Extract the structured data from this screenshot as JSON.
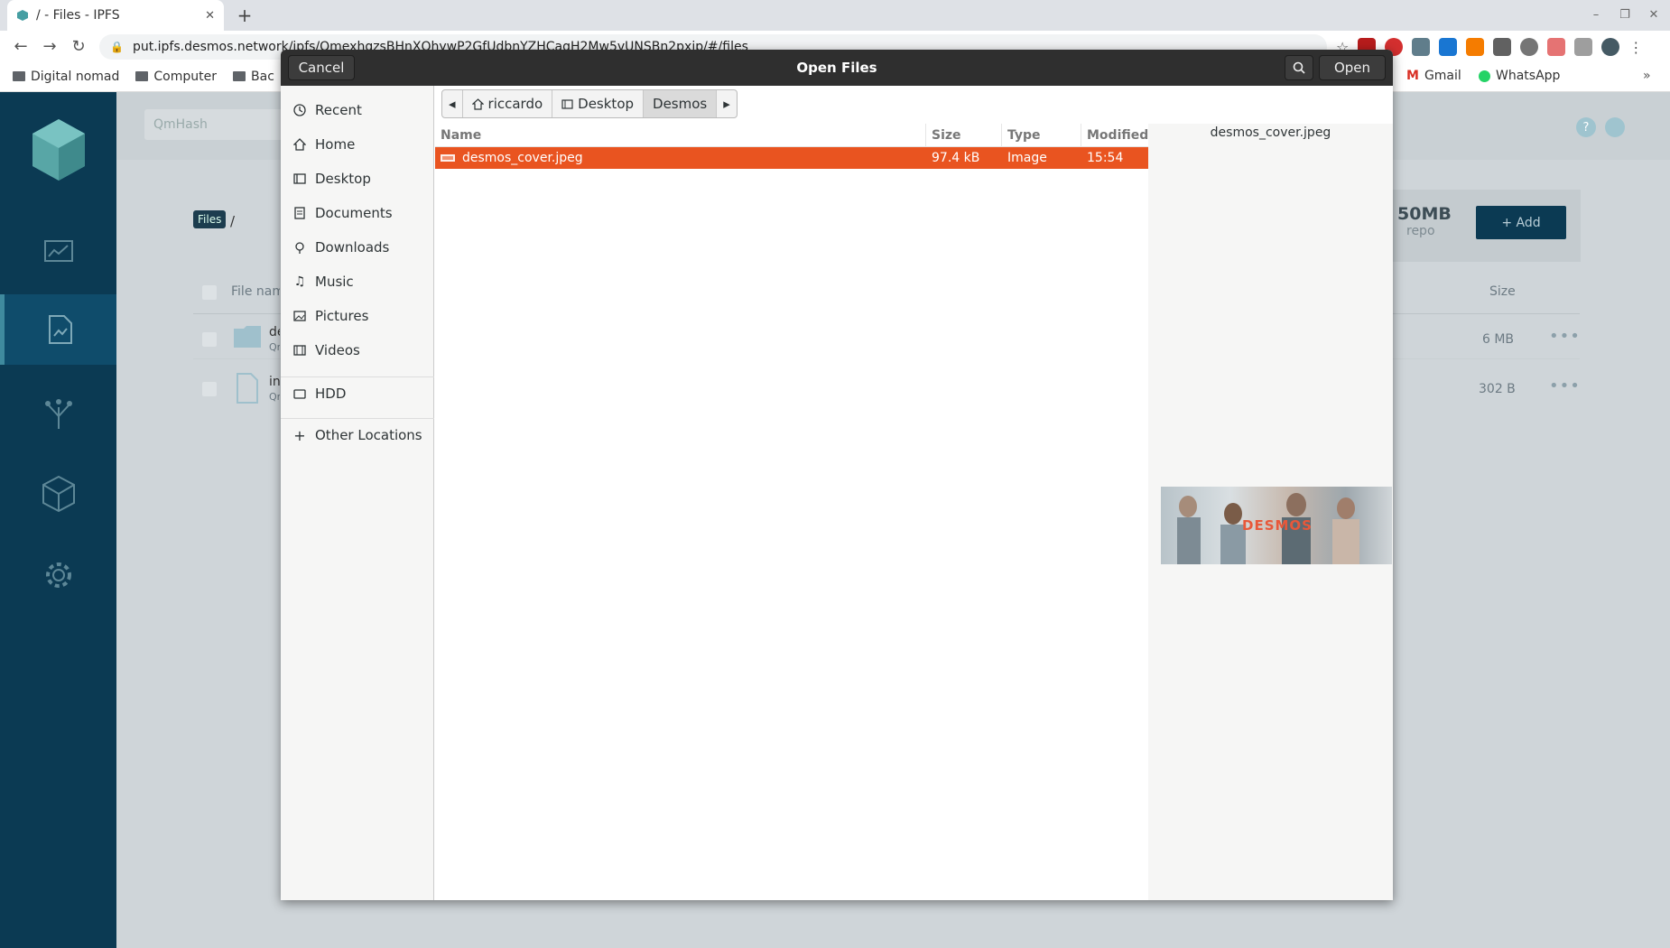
{
  "browser": {
    "tab_title": "/ - Files - IPFS",
    "new_tab": "+",
    "url": "put.ipfs.desmos.network/ipfs/QmexhqzsBHnXQhywP2GfUdbnYZHCagH2Mw5vUNSBn2pxjp/#/files",
    "bookmarks": [
      "Digital nomad",
      "Computer",
      "Bac",
      "Gmail",
      "WhatsApp"
    ],
    "bookmarks_more": "»"
  },
  "page": {
    "search_placeholder": "QmHash",
    "breadcrumb_files": "Files",
    "breadcrumb_sep": "/",
    "repo_size": "50MB",
    "repo_label": "repo",
    "add_button": "+ Add",
    "col_filename": "File name",
    "col_size": "Size",
    "rows": [
      {
        "name": "de",
        "sub": "Qm",
        "size": "6 MB",
        "kind": "folder"
      },
      {
        "name": "in",
        "sub": "Qm",
        "size": "302 B",
        "kind": "file"
      }
    ],
    "help_icon": "?"
  },
  "dialog": {
    "title": "Open Files",
    "cancel": "Cancel",
    "open": "Open",
    "places": [
      {
        "label": "Recent",
        "icon": "clock-icon"
      },
      {
        "label": "Home",
        "icon": "home-icon"
      },
      {
        "label": "Desktop",
        "icon": "desktop-icon"
      },
      {
        "label": "Documents",
        "icon": "document-icon"
      },
      {
        "label": "Downloads",
        "icon": "download-icon"
      },
      {
        "label": "Music",
        "icon": "music-icon"
      },
      {
        "label": "Pictures",
        "icon": "picture-icon"
      },
      {
        "label": "Videos",
        "icon": "video-icon"
      },
      {
        "label": "HDD",
        "icon": "drive-icon"
      },
      {
        "label": "Other Locations",
        "icon": "plus-icon"
      }
    ],
    "path": [
      "riccardo",
      "Desktop",
      "Desmos"
    ],
    "columns": {
      "name": "Name",
      "size": "Size",
      "type": "Type",
      "modified": "Modified"
    },
    "files": [
      {
        "name": "desmos_cover.jpeg",
        "size": "97.4 kB",
        "type": "Image",
        "modified": "15:54"
      }
    ],
    "preview_name": "desmos_cover.jpeg",
    "preview_brand": "DESMOS"
  },
  "colors": {
    "accent": "#e95420",
    "sidebar": "#0b3a53",
    "header": "#2f2f2f"
  }
}
